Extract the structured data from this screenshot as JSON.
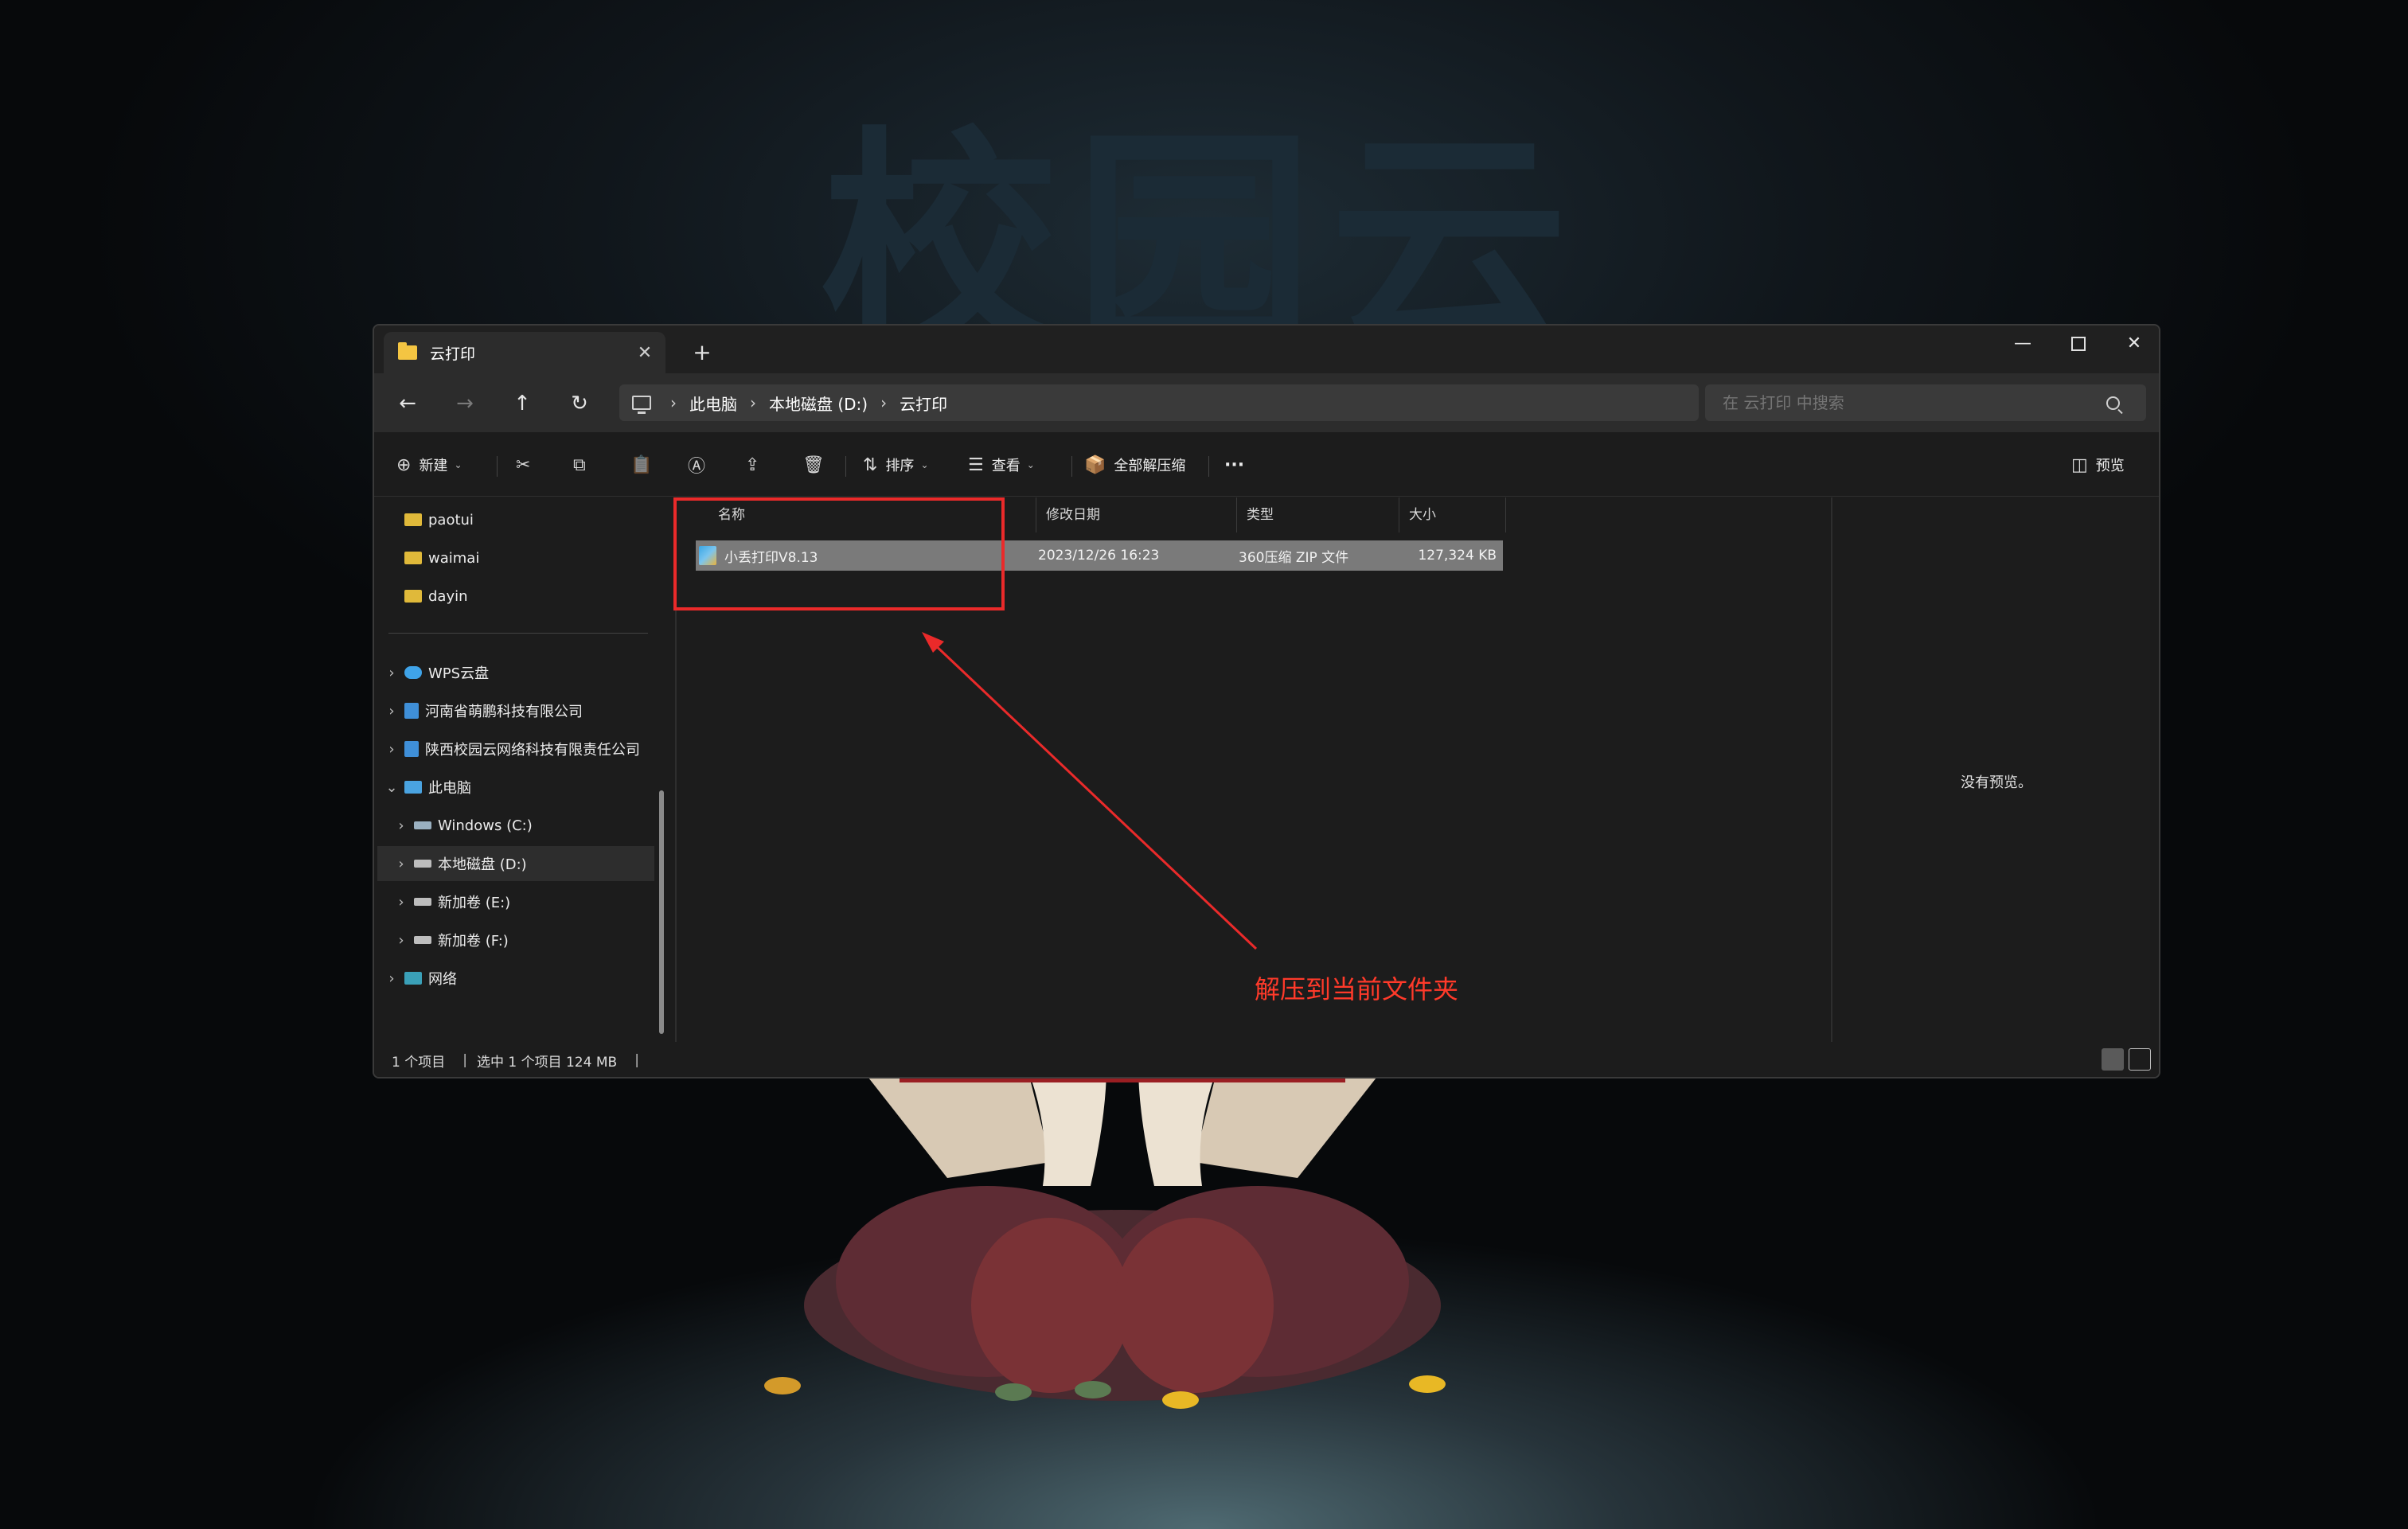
{
  "wallpaper": {
    "title": "校园云"
  },
  "window": {
    "tab_title": "云打印",
    "tab_close": "✕",
    "new_tab": "+",
    "controls": {
      "minimize": "—",
      "close": "✕"
    }
  },
  "address": {
    "back": "←",
    "forward": "→",
    "up": "↑",
    "refresh": "↻",
    "breadcrumbs": [
      "此电脑",
      "本地磁盘 (D:)",
      "云打印"
    ],
    "separator": "›",
    "search_placeholder": "在 云打印 中搜索"
  },
  "toolbar": {
    "new_label": "新建",
    "sort_label": "排序",
    "view_label": "查看",
    "extract_all_label": "全部解压缩",
    "more_label": "···",
    "preview_label": "预览",
    "icons": {
      "new": "⊕",
      "cut": "✂",
      "copy": "⧉",
      "paste": "📋",
      "rename": "Ⓐ",
      "share": "⇪",
      "delete": "🗑",
      "sort": "⇅",
      "view": "☰",
      "extract": "📦",
      "preview": "◫"
    }
  },
  "nav": {
    "items": [
      {
        "label": "paotui",
        "icon": "folder-icon"
      },
      {
        "label": "waimai",
        "icon": "folder-icon"
      },
      {
        "label": "dayin",
        "icon": "folder-icon"
      },
      {
        "label": "WPS云盘",
        "icon": "cloud-icon"
      },
      {
        "label": "河南省萌鹏科技有限公司",
        "icon": "building-icon"
      },
      {
        "label": "陕西校园云网络科技有限责任公司",
        "icon": "building-icon"
      },
      {
        "label": "此电脑",
        "icon": "pc-icon"
      },
      {
        "label": "Windows (C:)",
        "icon": "drive-icon"
      },
      {
        "label": "本地磁盘 (D:)",
        "icon": "drive-icon"
      },
      {
        "label": "新加卷 (E:)",
        "icon": "drive-icon"
      },
      {
        "label": "新加卷 (F:)",
        "icon": "drive-icon"
      },
      {
        "label": "网络",
        "icon": "network-icon"
      }
    ],
    "chevron_right": "›",
    "chevron_down": "⌄"
  },
  "columns": [
    "名称",
    "修改日期",
    "类型",
    "大小"
  ],
  "files": [
    {
      "name": "小丢打印V8.13",
      "modified": "2023/12/26 16:23",
      "type": "360压缩 ZIP 文件",
      "size": "127,324 KB"
    }
  ],
  "preview": {
    "empty_text": "没有预览。"
  },
  "status": {
    "item_count": "1 个项目",
    "selected": "选中 1 个项目  124 MB",
    "separator": "|"
  },
  "annotation": {
    "text": "解压到当前文件夹",
    "color": "#ea2a2a"
  },
  "colors": {
    "accent": "#4cc2ff",
    "folder": "#f4c542",
    "annotation": "#ea2a2a"
  }
}
